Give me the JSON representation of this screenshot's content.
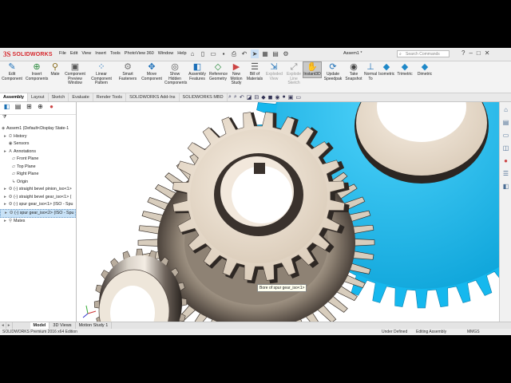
{
  "app": {
    "brand_ds": "3S",
    "brand_name": "SOLIDWORKS",
    "menus": [
      "File",
      "Edit",
      "View",
      "Insert",
      "Tools",
      "PhotoView 360",
      "Window",
      "Help"
    ],
    "document_title": "Assem1 *",
    "search_placeholder": "Search Commands"
  },
  "ribbon": {
    "buttons": [
      {
        "label": "Edit\nComponent",
        "icon": "edit-component-icon",
        "glyph": "✎"
      },
      {
        "label": "Insert\nComponents",
        "icon": "insert-components-icon",
        "glyph": "⊕"
      },
      {
        "label": "Mate",
        "icon": "mate-icon",
        "glyph": "⚲"
      },
      {
        "label": "Component\nPreview\nWindow",
        "icon": "preview-window-icon",
        "glyph": "▣"
      },
      {
        "label": "Linear Component\nPattern",
        "icon": "linear-pattern-icon",
        "glyph": "⁘"
      },
      {
        "label": "Smart\nFasteners",
        "icon": "smart-fasteners-icon",
        "glyph": "⚙"
      },
      {
        "label": "Move\nComponent",
        "icon": "move-component-icon",
        "glyph": "✥"
      },
      {
        "label": "Show\nHidden\nComponents",
        "icon": "show-hidden-icon",
        "glyph": "◎"
      },
      {
        "label": "Assembly\nFeatures",
        "icon": "assembly-features-icon",
        "glyph": "◧"
      },
      {
        "label": "Reference\nGeometry",
        "icon": "reference-geometry-icon",
        "glyph": "◇"
      },
      {
        "label": "New\nMotion\nStudy",
        "icon": "motion-study-icon",
        "glyph": "▶"
      },
      {
        "label": "Bill of\nMaterials",
        "icon": "bom-icon",
        "glyph": "☰"
      },
      {
        "label": "Exploded\nView",
        "icon": "exploded-view-icon",
        "glyph": "⇲"
      },
      {
        "label": "Explode\nLine\nSketch",
        "icon": "explode-line-icon",
        "glyph": "⤢"
      },
      {
        "label": "Instant3D",
        "icon": "instant3d-icon",
        "glyph": "✋"
      },
      {
        "label": "Update\nSpeedpak",
        "icon": "speedpak-icon",
        "glyph": "⟳"
      },
      {
        "label": "Take\nSnapshot",
        "icon": "camera-icon",
        "glyph": "◉"
      },
      {
        "label": "Normal\nTo",
        "icon": "normal-to-icon",
        "glyph": "⊥"
      },
      {
        "label": "Isometric",
        "icon": "isometric-icon",
        "glyph": "◆"
      },
      {
        "label": "Trimetric",
        "icon": "trimetric-icon",
        "glyph": "◆"
      },
      {
        "label": "Dimetric",
        "icon": "dimetric-icon",
        "glyph": "◆"
      }
    ],
    "active_index": 14
  },
  "command_tabs": [
    "Assembly",
    "Layout",
    "Sketch",
    "Evaluate",
    "Render Tools",
    "SOLIDWORKS Add-Ins",
    "SOLIDWORKS MBD"
  ],
  "active_command_tab": 0,
  "feature_tree": {
    "root": "Assem1  (Default<Display State-1",
    "items": [
      {
        "label": "History",
        "icon": "history-icon",
        "glyph": "⏲",
        "indent": 1,
        "expand": "▸"
      },
      {
        "label": "Sensors",
        "icon": "sensor-icon",
        "glyph": "◉",
        "indent": 1,
        "expand": ""
      },
      {
        "label": "Annotations",
        "icon": "annotations-icon",
        "glyph": "A",
        "indent": 1,
        "expand": "▸"
      },
      {
        "label": "Front Plane",
        "icon": "plane-icon",
        "glyph": "▱",
        "indent": 2,
        "expand": ""
      },
      {
        "label": "Top Plane",
        "icon": "plane-icon",
        "glyph": "▱",
        "indent": 2,
        "expand": ""
      },
      {
        "label": "Right Plane",
        "icon": "plane-icon",
        "glyph": "▱",
        "indent": 2,
        "expand": ""
      },
      {
        "label": "Origin",
        "icon": "origin-icon",
        "glyph": "↳",
        "indent": 2,
        "expand": ""
      },
      {
        "label": "(-) straight bevel pinion_iso<1>",
        "icon": "part-icon",
        "glyph": "⚙",
        "indent": 1,
        "expand": "▸"
      },
      {
        "label": "(-) straight bevel gear_iso<1> (",
        "icon": "part-icon",
        "glyph": "⚙",
        "indent": 1,
        "expand": "▸"
      },
      {
        "label": "(-) spur gear_iso<1> (ISO - Spu",
        "icon": "part-icon",
        "glyph": "⚙",
        "indent": 1,
        "expand": "▸"
      },
      {
        "label": "(-) spur gear_iso<2> (ISO - Spu",
        "icon": "part-icon",
        "glyph": "⚙",
        "indent": 1,
        "expand": "▸",
        "selected": true
      },
      {
        "label": "Mates",
        "icon": "mates-icon",
        "glyph": "⚲",
        "indent": 1,
        "expand": "▸"
      }
    ]
  },
  "tooltip": "Bore of spur gear_iso<1>",
  "bottom_tabs": [
    "Model",
    "3D Views",
    "Motion Study 1"
  ],
  "active_bottom_tab": 0,
  "status": {
    "edition": "SOLIDWORKS Premium 2016 x64 Edition",
    "definition": "Under Defined",
    "mode": "Editing Assembly",
    "units": "MMGS"
  },
  "colors": {
    "selected_gear": "#15b8ee",
    "gear_face": "#efe3d3",
    "brand": "#d6262b"
  }
}
